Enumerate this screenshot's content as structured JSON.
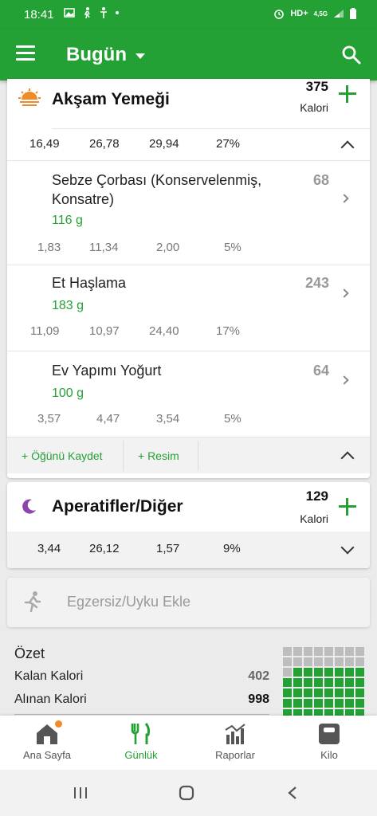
{
  "status_bar": {
    "time": "18:41",
    "network": "HD+",
    "net_type": "4,5G"
  },
  "app_bar": {
    "title": "Bugün"
  },
  "dinner": {
    "title": "Akşam Yemeği",
    "calories": "375",
    "calorie_label": "Kalori",
    "macros": [
      "16,49",
      "26,78",
      "29,94",
      "27%"
    ],
    "foods": [
      {
        "name": "Sebze Çorbası (Konservelenmiş, Konsatre)",
        "grams": "116  g",
        "calories": "68",
        "macros": [
          "1,83",
          "11,34",
          "2,00",
          "5%"
        ]
      },
      {
        "name": "Et Haşlama",
        "grams": "183  g",
        "calories": "243",
        "macros": [
          "11,09",
          "10,97",
          "24,40",
          "17%"
        ]
      },
      {
        "name": "Ev Yapımı Yoğurt",
        "grams": "100  g",
        "calories": "64",
        "macros": [
          "3,57",
          "4,47",
          "3,54",
          "5%"
        ]
      }
    ],
    "save_meal": "+ Öğünü Kaydet",
    "add_photo": "+ Resim"
  },
  "snacks": {
    "title": "Aperatifler/Diğer",
    "calories": "129",
    "calorie_label": "Kalori",
    "macros": [
      "3,44",
      "26,12",
      "1,57",
      "9%"
    ]
  },
  "exercise": {
    "label": "Egzersiz/Uyku Ekle"
  },
  "summary": {
    "title": "Özet",
    "remaining_label": "Kalan Kalori",
    "remaining_value": "402",
    "consumed_label": "Alınan Kalori",
    "consumed_value": "998",
    "grid_fill_fraction": 0.7
  },
  "bottom_nav": [
    "Ana Sayfa",
    "Günlük",
    "Raporlar",
    "Kilo"
  ],
  "colors": {
    "primary": "#23a135",
    "badge": "#f08c28",
    "snack_moon": "#8e44ad",
    "sunset": "#f08c28"
  }
}
